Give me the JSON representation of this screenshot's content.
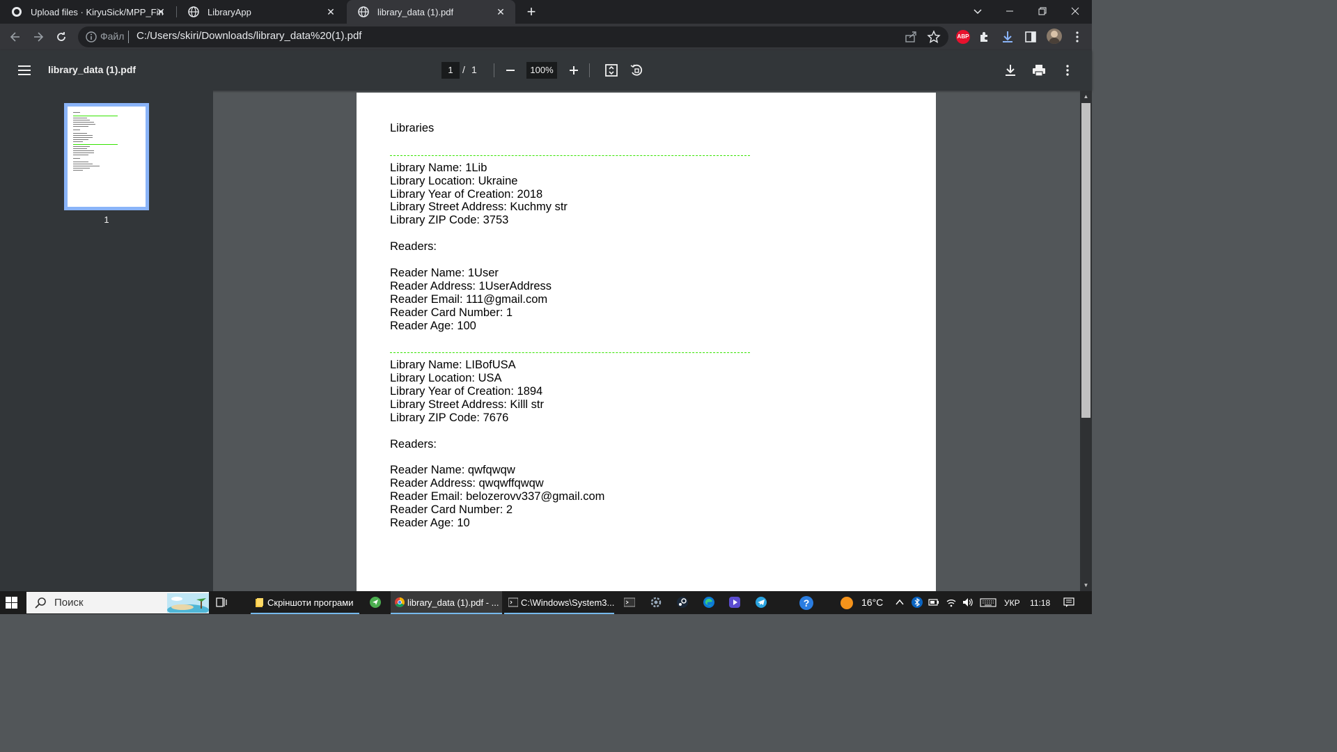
{
  "browser": {
    "tabs": [
      {
        "title": "Upload files · KiryuSick/MPP_Fin",
        "active": false
      },
      {
        "title": "LibraryApp",
        "active": false
      },
      {
        "title": "library_data (1).pdf",
        "active": true
      }
    ],
    "omnibox": {
      "scheme_label": "Файл",
      "url": "C:/Users/skiri/Downloads/library_data%20(1).pdf"
    },
    "extension_badge": "ABP"
  },
  "pdf_viewer": {
    "title": "library_data (1).pdf",
    "page_current": "1",
    "page_separator": "/",
    "page_total": "1",
    "zoom": "100%",
    "thumbnail_label": "1"
  },
  "document": {
    "heading": "Libraries",
    "libraries": [
      {
        "lines": [
          "Library Name: 1Lib",
          "Library Location: Ukraine",
          "Library Year of Creation: 2018",
          "Library Street Address: Kuchmy str",
          "Library ZIP Code: 3753"
        ],
        "readers_heading": "Readers:",
        "reader_lines": [
          "Reader Name: 1User",
          "Reader Address: 1UserAddress",
          "Reader Email: 111@gmail.com",
          "Reader Card Number: 1",
          "Reader Age: 100"
        ]
      },
      {
        "lines": [
          "Library Name: LIBofUSA",
          "Library Location: USA",
          "Library Year of Creation: 1894",
          "Library Street Address: Killl str",
          "Library ZIP Code: 7676"
        ],
        "readers_heading": "Readers:",
        "reader_lines": [
          "Reader Name: qwfqwqw",
          "Reader Address: qwqwffqwqw",
          "Reader Email: belozerovv337@gmail.com",
          "Reader Card Number: 2",
          "Reader Age: 10"
        ]
      }
    ],
    "separator_color": "#35e400"
  },
  "taskbar": {
    "search_placeholder": "Поиск",
    "apps": [
      {
        "label": "Скріншоти програми",
        "active": false
      },
      {
        "label": "library_data (1).pdf - ...",
        "active": true
      },
      {
        "label": "C:\\Windows\\System3...",
        "active": false
      }
    ],
    "temperature": "16°C",
    "language": "УКР",
    "time": "11:18"
  }
}
